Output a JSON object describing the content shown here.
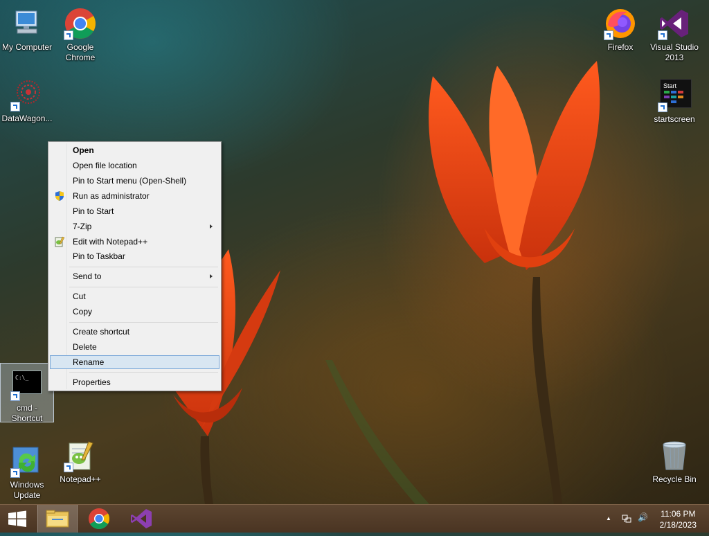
{
  "desktop_icons": {
    "my_computer": {
      "label": "My Computer"
    },
    "chrome": {
      "label": "Google Chrome"
    },
    "datawagon": {
      "label": "DataWagon..."
    },
    "firefox": {
      "label": "Firefox"
    },
    "vs2013": {
      "label": "Visual Studio 2013"
    },
    "startscreen": {
      "label": "startscreen",
      "tile_text": "Start"
    },
    "cmd": {
      "label": "cmd - Shortcut",
      "tile_text": "C:\\_"
    },
    "windows_update": {
      "label": "Windows Update"
    },
    "notepadpp": {
      "label": "Notepad++"
    },
    "recycle_bin": {
      "label": "Recycle Bin"
    }
  },
  "context_menu": {
    "items": [
      {
        "label": "Open"
      },
      {
        "label": "Open file location"
      },
      {
        "label": "Pin to Start menu (Open-Shell)"
      },
      {
        "label": "Run as administrator"
      },
      {
        "label": "Pin to Start"
      },
      {
        "label": "7-Zip"
      },
      {
        "label": "Edit with Notepad++"
      },
      {
        "label": "Pin to Taskbar"
      },
      {
        "label": "Send to"
      },
      {
        "label": "Cut"
      },
      {
        "label": "Copy"
      },
      {
        "label": "Create shortcut"
      },
      {
        "label": "Delete"
      },
      {
        "label": "Rename"
      },
      {
        "label": "Properties"
      }
    ]
  },
  "taskbar": {
    "clock_time": "11:06 PM",
    "clock_date": "2/18/2023",
    "tray_chevron": "▲",
    "tray_volume": "🔊"
  },
  "colors": {
    "menu_hover": "#d8e6f2",
    "taskbar": "#4a3422",
    "accent_blue": "#1f6fd1"
  }
}
